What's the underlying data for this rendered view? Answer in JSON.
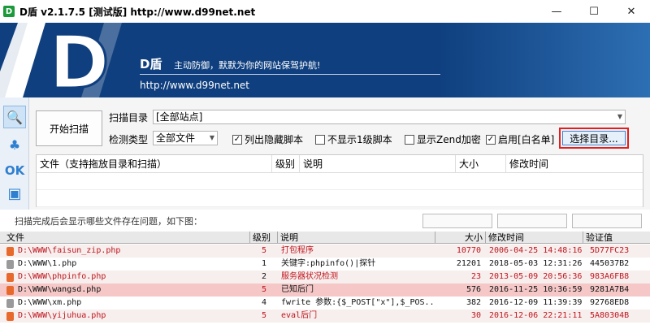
{
  "window": {
    "title": "D盾 v2.1.7.5 [测试版] http://www.d99net.net",
    "icon_letter": "D",
    "buttons": [
      "—",
      "☐",
      "✕"
    ]
  },
  "banner": {
    "brand": "D盾",
    "slogan": "主动防御，默默为你的网站保驾护航!",
    "url": "http://www.d99net.net"
  },
  "sidebar": {
    "items": [
      {
        "icon": "search-icon",
        "glyph": "🔍"
      },
      {
        "icon": "process-icon",
        "glyph": "♣"
      },
      {
        "icon": "ok-icon",
        "glyph": "OK"
      },
      {
        "icon": "window-icon",
        "glyph": "▣"
      }
    ]
  },
  "scan": {
    "start_label": "开始扫描",
    "dir_label": "扫描目录",
    "dir_value": "[全部站点]",
    "type_label": "检测类型",
    "type_value": "全部文件",
    "options": [
      {
        "label": "列出隐藏脚本",
        "checked": true
      },
      {
        "label": "不显示1级脚本",
        "checked": false
      },
      {
        "label": "显示Zend加密",
        "checked": false
      },
      {
        "label": "启用[白名单]",
        "checked": true
      }
    ],
    "select_dir_label": "选择目录..."
  },
  "grid1": {
    "columns": [
      "文件（支持拖放目录和扫描）",
      "级别",
      "说明",
      "大小",
      "修改时间"
    ]
  },
  "caption": "扫描完成后会显示哪些文件存在问题，如下图：",
  "results": {
    "columns": [
      "文件",
      "级别",
      "说明",
      "大小",
      "修改时间",
      "验证值"
    ],
    "rows": [
      {
        "file": "D:\\WWW\\faisun_zip.php",
        "level": "5",
        "desc": "打包程序",
        "size": "10770",
        "mtime": "2006-04-25 14:48:16",
        "hash": "5D77FC23",
        "color": "red",
        "bg": "#f7eeee",
        "icon_color": "#e8692c"
      },
      {
        "file": "D:\\WWW\\1.php",
        "level": "1",
        "desc": "关键字:phpinfo()|探针",
        "size": "21201",
        "mtime": "2018-05-03 12:31:26",
        "hash": "445037B2",
        "color": "black",
        "bg": "#ffffff",
        "icon_color": "#9a9a9a"
      },
      {
        "file": "D:\\WWW\\phpinfo.php",
        "level": "2",
        "desc": "服务器状况检测",
        "size": "23",
        "mtime": "2013-05-09 20:56:36",
        "hash": "983A6FB8",
        "color": "red",
        "bg": "#f7eeee",
        "icon_color": "#e8692c"
      },
      {
        "file": "D:\\WWW\\wangsd.php",
        "level": "5",
        "desc": "已知后门",
        "size": "576",
        "mtime": "2016-11-25 10:36:59",
        "hash": "9281A7B4",
        "color": "black",
        "bg": "#f5c7c7",
        "icon_color": "#e8692c"
      },
      {
        "file": "D:\\WWW\\xm.php",
        "level": "4",
        "desc": "fwrite 参数:{$_POST[\"x\"],$_POS...",
        "size": "382",
        "mtime": "2016-12-09 11:39:39",
        "hash": "92768ED8",
        "color": "black",
        "bg": "#ffffff",
        "icon_color": "#9a9a9a"
      },
      {
        "file": "D:\\WWW\\yijuhua.php",
        "level": "5",
        "desc": "eval后门",
        "size": "30",
        "mtime": "2016-12-06 22:21:11",
        "hash": "5A80304B",
        "color": "red",
        "bg": "#f7eeee",
        "icon_color": "#e8692c"
      }
    ]
  }
}
